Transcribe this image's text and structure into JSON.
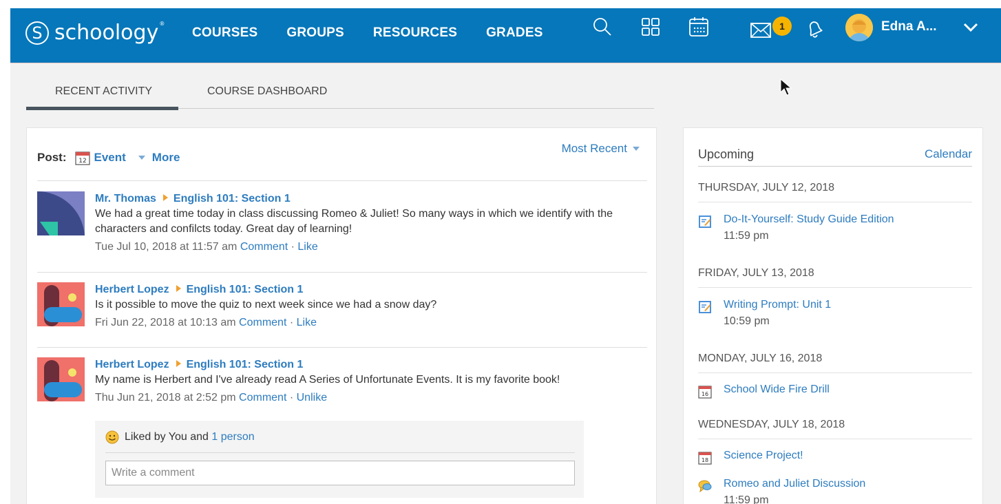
{
  "brand": {
    "name": "schoology",
    "mark": "S",
    "tm": "®"
  },
  "nav": [
    "COURSES",
    "GROUPS",
    "RESOURCES",
    "GRADES"
  ],
  "header": {
    "messages_badge": "1",
    "user_name": "Edna A..."
  },
  "tabs": {
    "recent": "RECENT ACTIVITY",
    "dashboard": "COURSE DASHBOARD"
  },
  "post_bar": {
    "label": "Post:",
    "calendar_day": "12",
    "event": "Event",
    "more": "More",
    "sort": "Most Recent"
  },
  "feed": [
    {
      "author": "Mr. Thomas",
      "course": "English 101: Section 1",
      "text": "We had a great time today in class discussing Romeo & Juliet! So many ways in which we identify with the characters and confilcts today. Great day of learning!",
      "time": "Tue Jul 10, 2018 at 11:57 am",
      "comment": "Comment",
      "like": "Like"
    },
    {
      "author": "Herbert Lopez",
      "course": "English 101: Section 1",
      "text": "Is it possible to move the quiz to next week since we had a snow day?",
      "time": "Fri Jun 22, 2018 at 10:13 am",
      "comment": "Comment",
      "like": "Like"
    },
    {
      "author": "Herbert Lopez",
      "course": "English 101: Section 1",
      "text": "My name is Herbert and I've already read A Series of Unfortunate Events. It is my favorite book!",
      "time": "Thu Jun 21, 2018 at 2:52 pm",
      "comment": "Comment",
      "like": "Unlike"
    }
  ],
  "likes": {
    "prefix": "Liked by You and ",
    "link": "1 person",
    "comment_placeholder": "Write a comment"
  },
  "upcoming": {
    "title": "Upcoming",
    "calendar_link": "Calendar",
    "days": [
      "THURSDAY, JULY 12, 2018",
      "FRIDAY, JULY 13, 2018",
      "MONDAY, JULY 16, 2018",
      "WEDNESDAY, JULY 18, 2018"
    ],
    "events": [
      {
        "title": "Do-It-Yourself: Study Guide Edition",
        "time": "11:59 pm",
        "icon": "assignment-icon"
      },
      {
        "title": "Writing Prompt: Unit 1",
        "time": "10:59 pm",
        "icon": "assignment-icon"
      },
      {
        "title": "School Wide Fire Drill",
        "time": "",
        "icon": "calendar-icon",
        "day": "16"
      },
      {
        "title": "Science Project!",
        "time": "",
        "icon": "calendar-icon",
        "day": "18"
      },
      {
        "title": "Romeo and Juliet Discussion",
        "time": "11:59 pm",
        "icon": "discussion-icon"
      }
    ]
  },
  "colors": {
    "topbar": "#0677ba",
    "link": "#2d7cbf",
    "badge": "#f6b400"
  }
}
